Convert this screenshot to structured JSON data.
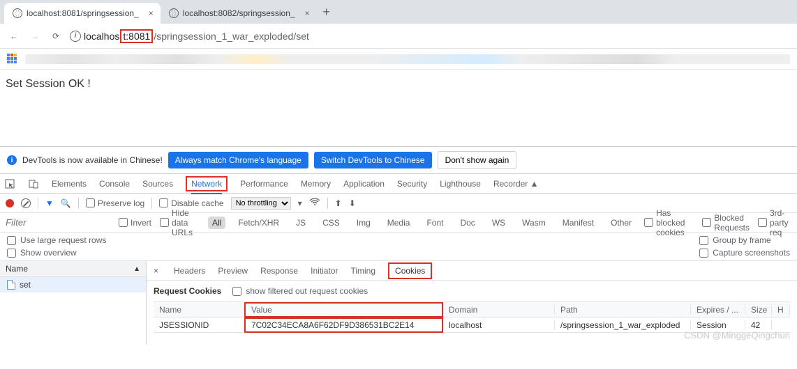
{
  "browser": {
    "tabs": [
      {
        "title": "localhost:8081/springsession_",
        "active": true
      },
      {
        "title": "localhost:8082/springsession_",
        "active": false
      }
    ],
    "nav": {
      "back": "←",
      "forward": "→",
      "reload": "⟳"
    },
    "url": {
      "host_prefix": "localhos",
      "host_port_hl": "t:8081",
      "path": "/springsession_1_war_exploded/set"
    }
  },
  "page_body": "Set Session OK !",
  "notice": {
    "text": "DevTools is now available in Chinese!",
    "btn_match": "Always match Chrome's language",
    "btn_switch": "Switch DevTools to Chinese",
    "btn_dismiss": "Don't show again"
  },
  "devtabs": [
    "Elements",
    "Console",
    "Sources",
    "Network",
    "Performance",
    "Memory",
    "Application",
    "Security",
    "Lighthouse",
    "Recorder"
  ],
  "devtabs_active": "Network",
  "nettoolbar": {
    "preserve": "Preserve log",
    "disable_cache": "Disable cache",
    "throttling": "No throttling"
  },
  "filter": {
    "placeholder": "Filter",
    "invert": "Invert",
    "hide_data": "Hide data URLs",
    "types": [
      "All",
      "Fetch/XHR",
      "JS",
      "CSS",
      "Img",
      "Media",
      "Font",
      "Doc",
      "WS",
      "Wasm",
      "Manifest",
      "Other"
    ],
    "type_active": "All",
    "blocked_cookies": "Has blocked cookies",
    "blocked_req": "Blocked Requests",
    "third_party": "3rd-party req"
  },
  "options": {
    "large_rows": "Use large request rows",
    "show_overview": "Show overview",
    "group_frame": "Group by frame",
    "capture": "Capture screenshots"
  },
  "reqlist": {
    "header": "Name",
    "items": [
      "set"
    ]
  },
  "subtabs": [
    "Headers",
    "Preview",
    "Response",
    "Initiator",
    "Timing",
    "Cookies"
  ],
  "cookies": {
    "section_title": "Request Cookies",
    "filter_label": "show filtered out request cookies",
    "columns": {
      "name": "Name",
      "value": "Value",
      "domain": "Domain",
      "path": "Path",
      "expires": "Expires / ...",
      "size": "Size",
      "h": "H"
    },
    "rows": [
      {
        "name": "JSESSIONID",
        "value": "7C02C34ECA8A6F62DF9D386531BC2E14",
        "domain": "localhost",
        "path": "/springsession_1_war_exploded",
        "expires": "Session",
        "size": "42",
        "h": ""
      }
    ]
  },
  "watermark": "CSDN @MinggeQingchun"
}
